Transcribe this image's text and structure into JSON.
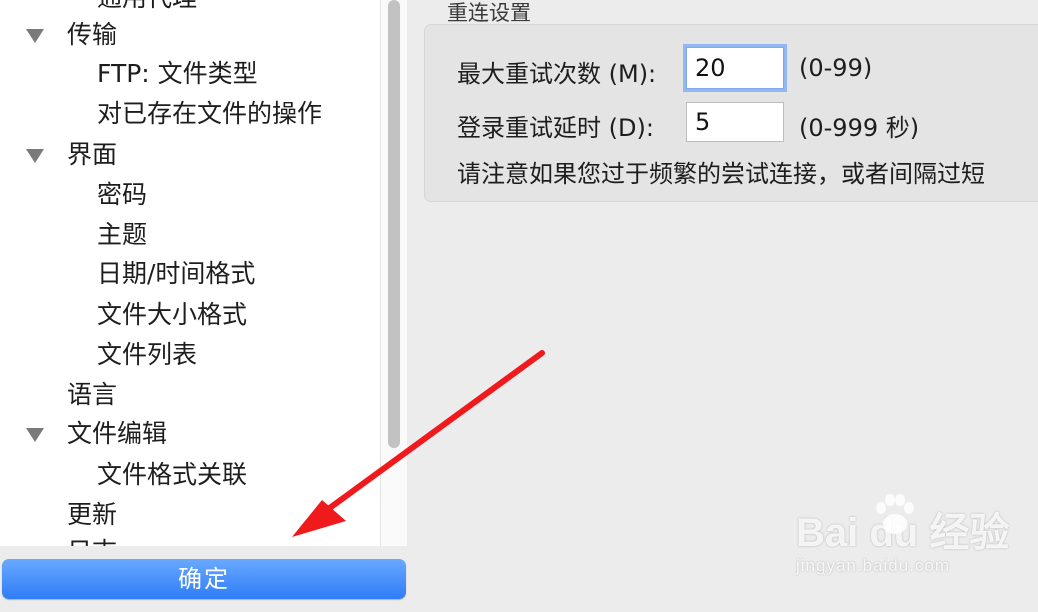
{
  "tree": {
    "items": [
      {
        "label": "通用代理",
        "level": 1,
        "expanded": false
      },
      {
        "label": "传输",
        "level": 0,
        "expanded": true
      },
      {
        "label": "FTP: 文件类型",
        "level": 1,
        "expanded": false
      },
      {
        "label": "对已存在文件的操作",
        "level": 1,
        "expanded": false
      },
      {
        "label": "界面",
        "level": 0,
        "expanded": true
      },
      {
        "label": "密码",
        "level": 1,
        "expanded": false
      },
      {
        "label": "主题",
        "level": 1,
        "expanded": false
      },
      {
        "label": "日期/时间格式",
        "level": 1,
        "expanded": false
      },
      {
        "label": "文件大小格式",
        "level": 1,
        "expanded": false
      },
      {
        "label": "文件列表",
        "level": 1,
        "expanded": false
      },
      {
        "label": "语言",
        "level": 0,
        "expanded": false
      },
      {
        "label": "文件编辑",
        "level": 0,
        "expanded": true
      },
      {
        "label": "文件格式关联",
        "level": 1,
        "expanded": false
      },
      {
        "label": "更新",
        "level": 0,
        "expanded": false
      },
      {
        "label": "日志",
        "level": 0,
        "expanded": false
      }
    ]
  },
  "buttons": {
    "ok_label": "确定"
  },
  "reconnect": {
    "group_title": "重连设置",
    "max_retries_label": "最大重试次数 (M):",
    "max_retries_value": "20",
    "max_retries_hint": "(0-99)",
    "login_delay_label": "登录重试延时 (D):",
    "login_delay_value": "5",
    "login_delay_hint": "(0-999 秒)",
    "notice": "请注意如果您过于频繁的尝试连接，或者间隔过短"
  },
  "watermark": {
    "logo_text": "Bai du 经验",
    "url": "jingyan.baidu.com"
  },
  "colors": {
    "accent": "#2f7cf6",
    "annotation_arrow": "#f0191c"
  }
}
